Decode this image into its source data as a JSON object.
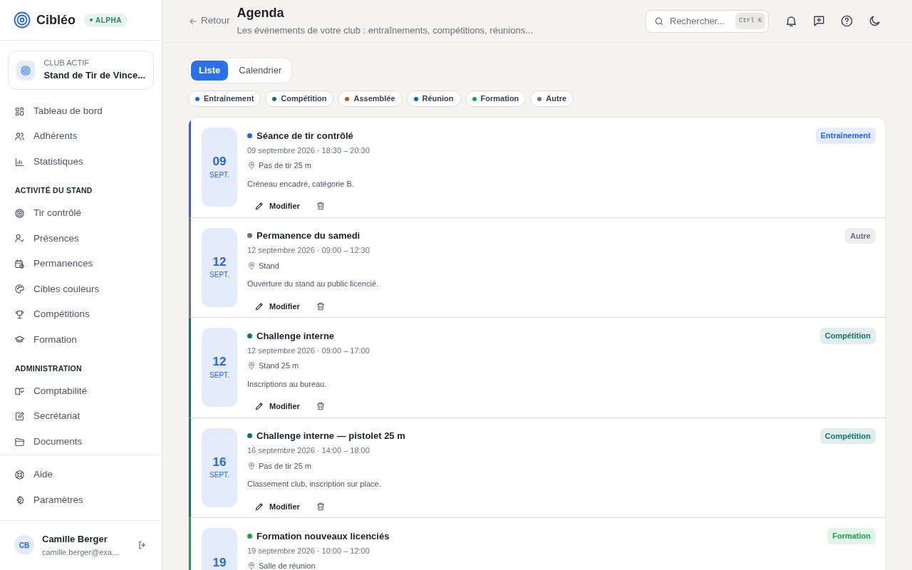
{
  "brand": {
    "name": "Cibléo",
    "badge": "ALPHA"
  },
  "club": {
    "label": "CLUB ACTIF",
    "name": "Stand de Tir de Vince..."
  },
  "sidebar": {
    "groups": [
      {
        "items": [
          {
            "label": "Tableau de bord",
            "selected": false
          },
          {
            "label": "Adhérents",
            "selected": false
          },
          {
            "label": "Statistiques",
            "selected": false
          }
        ]
      },
      {
        "heading": "ACTIVITÉ DU STAND",
        "items": [
          {
            "label": "Tir contrôlé",
            "selected": false
          },
          {
            "label": "Présences",
            "selected": false
          },
          {
            "label": "Permanences",
            "selected": false
          },
          {
            "label": "Cibles couleurs",
            "selected": false
          },
          {
            "label": "Compétitions",
            "selected": false
          },
          {
            "label": "Formation",
            "selected": false
          }
        ]
      },
      {
        "heading": "ADMINISTRATION",
        "items": [
          {
            "label": "Comptabilité",
            "selected": false
          },
          {
            "label": "Secrétariat",
            "selected": false
          },
          {
            "label": "Documents",
            "selected": false
          }
        ]
      }
    ],
    "footer_items": [
      {
        "label": "Aide"
      },
      {
        "label": "Paramètres"
      }
    ]
  },
  "user": {
    "initials": "CB",
    "name": "Camille Berger",
    "email": "camille.berger@exa..."
  },
  "header": {
    "back": "Retour",
    "title": "Agenda",
    "subtitle": "Les événements de votre club : entraînements, compétitions, réunions...",
    "search": {
      "placeholder": "Rechercher...",
      "shortcut": "Ctrl K"
    }
  },
  "view_tabs": [
    {
      "label": "Liste",
      "selected": true
    },
    {
      "label": "Calendrier",
      "selected": false
    }
  ],
  "filters": [
    {
      "label": "Entraînement",
      "color": "#2563eb"
    },
    {
      "label": "Compétition",
      "color": "#0f766e"
    },
    {
      "label": "Assemblée",
      "color": "#c2560c"
    },
    {
      "label": "Réunion",
      "color": "#0369a1"
    },
    {
      "label": "Formation",
      "color": "#16a34a"
    },
    {
      "label": "Autre",
      "color": "#6b7280"
    }
  ],
  "events": [
    {
      "day": "09",
      "month": "SEPT.",
      "title": "Séance de tir contrôlé",
      "when": "09 septembre 2026 · 18:30 – 20:30",
      "place": "Pas de tir 25 m",
      "description": "Créneau encadré, catégorie B.",
      "tag": "Entraînement",
      "color": "#2563eb",
      "edit": "Modifier"
    },
    {
      "day": "12",
      "month": "SEPT.",
      "title": "Permanence du samedi",
      "when": "12 septembre 2026 · 09:00 – 12:30",
      "place": "Stand",
      "description": "Ouverture du stand au public licencié.",
      "tag": "Autre",
      "color": "#6b7280",
      "edit": "Modifier"
    },
    {
      "day": "12",
      "month": "SEPT.",
      "title": "Challenge interne",
      "when": "12 septembre 2026 · 09:00 – 17:00",
      "place": "Stand 25 m",
      "description": "Inscriptions au bureau.",
      "tag": "Compétition",
      "color": "#0f766e",
      "edit": "Modifier"
    },
    {
      "day": "16",
      "month": "SEPT.",
      "title": "Challenge interne — pistolet 25 m",
      "when": "16 septembre 2026 · 14:00 – 18:00",
      "place": "Pas de tir 25 m",
      "description": "Classement club, inscription sur place.",
      "tag": "Compétition",
      "color": "#0f766e",
      "edit": "Modifier"
    },
    {
      "day": "19",
      "title": "Formation nouveaux licenciés",
      "when": "19 septembre 2026 · 10:00 – 12:00",
      "place": "Salle de réunion",
      "tag": "Formation",
      "color": "#16a34a"
    }
  ]
}
